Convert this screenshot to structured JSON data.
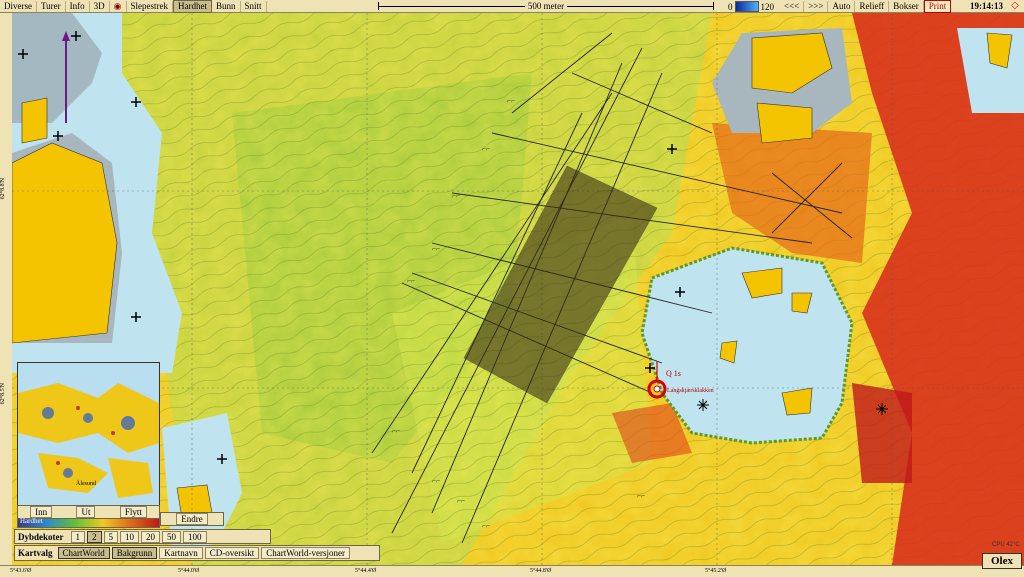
{
  "menu": {
    "items": [
      "Diverse",
      "Turer",
      "Info",
      "3D"
    ],
    "items2": [
      "Slepestrek",
      "Hardhet",
      "Bunn",
      "Snitt"
    ],
    "active": "Hardhet"
  },
  "scale_label": "500 meter",
  "depth": {
    "min": "0",
    "max": "120"
  },
  "tools": [
    "<<<",
    ">>>",
    "Auto",
    "Relieff",
    "Bokser",
    "Print"
  ],
  "clock": "19:14:13",
  "lat_labels": [
    "62°8.8'N",
    "62°8.5'N"
  ],
  "lon_labels": [
    "5°43.6'Ø",
    "5°44.0'Ø",
    "5°44.4'Ø",
    "5°44.8'Ø",
    "5°45.2'Ø"
  ],
  "minimap": {
    "buttons": [
      "Inn",
      "Ut",
      "Flytt"
    ],
    "place": "Ålesund"
  },
  "endre_label": "Endre",
  "hardhet_label": "Hardhet",
  "dybdekoter": {
    "label": "Dybdekoter",
    "values": [
      "1",
      "2",
      "5",
      "10",
      "20",
      "50",
      "100"
    ],
    "selected": "2"
  },
  "kartvalg": {
    "label": "Kartvalg",
    "items": [
      "ChartWorld",
      "Bakgrunn",
      "Kartnavn",
      "CD-oversikt",
      "ChartWorld-versjoner"
    ],
    "active": [
      "ChartWorld",
      "Bakgrunn"
    ]
  },
  "mark_label": "Langskjærsklakken",
  "q_label": "Q 1s",
  "cpu": "CPU 42°C",
  "brand": "Olex",
  "colors": {
    "chrome": "#efe3b5",
    "land": "#f5c400",
    "shallow": "#bfe3ef",
    "seabed_hard": "#d41b1b",
    "seabed_soft": "#5fbf3c"
  }
}
